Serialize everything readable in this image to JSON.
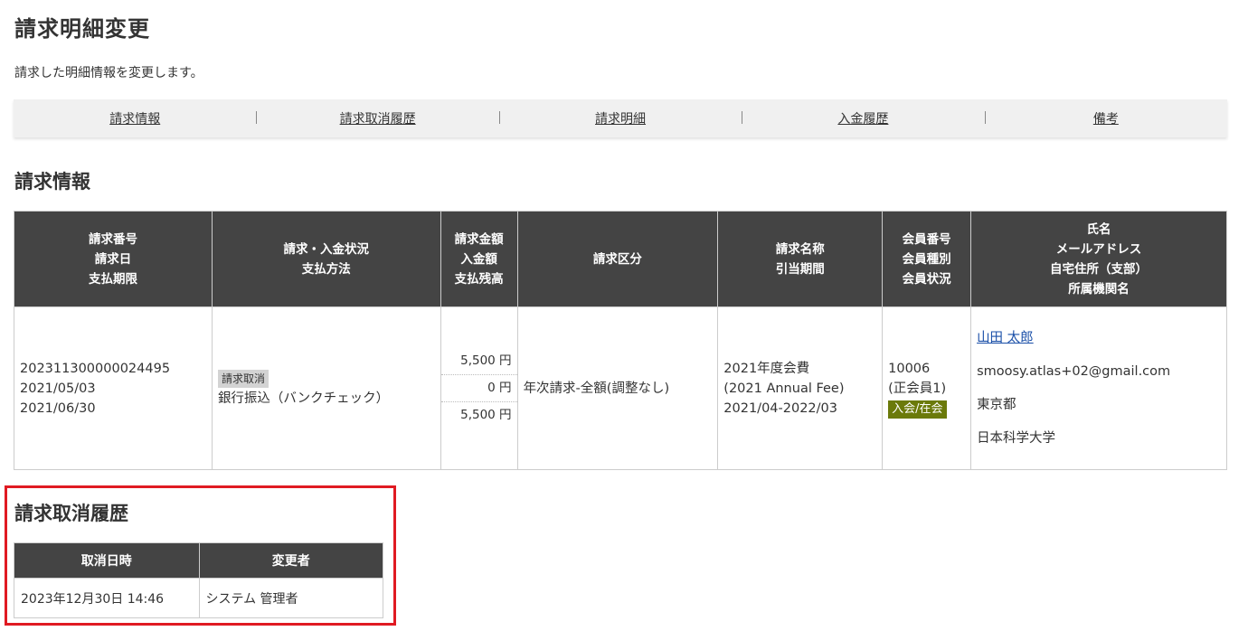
{
  "page": {
    "title": "請求明細変更",
    "description": "請求した明細情報を変更します。"
  },
  "tabs": [
    {
      "label": "請求情報"
    },
    {
      "label": "請求取消履歴"
    },
    {
      "label": "請求明細"
    },
    {
      "label": "入金履歴"
    },
    {
      "label": "備考"
    }
  ],
  "invoice_section": {
    "title": "請求情報",
    "headers": {
      "col1": [
        "請求番号",
        "請求日",
        "支払期限"
      ],
      "col2": [
        "請求・入金状況",
        "支払方法"
      ],
      "col3": [
        "請求金額",
        "入金額",
        "支払残高"
      ],
      "col4": [
        "請求区分"
      ],
      "col5": [
        "請求名称",
        "引当期間"
      ],
      "col6": [
        "会員番号",
        "会員種別",
        "会員状況"
      ],
      "col7": [
        "氏名",
        "メールアドレス",
        "自宅住所（支部）",
        "所属機関名"
      ]
    },
    "row": {
      "invoice_number": "202311300000024495",
      "invoice_date": "2021/05/03",
      "due_date": "2021/06/30",
      "status_badge": "請求取消",
      "payment_method": "銀行振込（バンクチェック）",
      "billed_amount": "5,500 円",
      "paid_amount": "0 円",
      "balance": "5,500 円",
      "category": "年次請求-全額(調整なし)",
      "name_line1": "2021年度会費",
      "name_line2": "(2021 Annual Fee)",
      "period": "2021/04-2022/03",
      "member_number": "10006",
      "member_type": "(正会員1)",
      "member_status": "入会/在会",
      "member_name": "山田 太郎",
      "email": "smoosy.atlas+02@gmail.com",
      "address": "東京都",
      "organization": "日本科学大学"
    }
  },
  "cancel_section": {
    "title": "請求取消履歴",
    "headers": [
      "取消日時",
      "変更者"
    ],
    "rows": [
      {
        "datetime": "2023年12月30日 14:46",
        "changed_by": "システム 管理者"
      }
    ]
  },
  "colors": {
    "header_bg": "#444444",
    "highlight_border": "#e01a22",
    "status_badge_bg": "#d3d3d3",
    "member_status_bg": "#6b7a0a",
    "link": "#1a4fa8"
  }
}
